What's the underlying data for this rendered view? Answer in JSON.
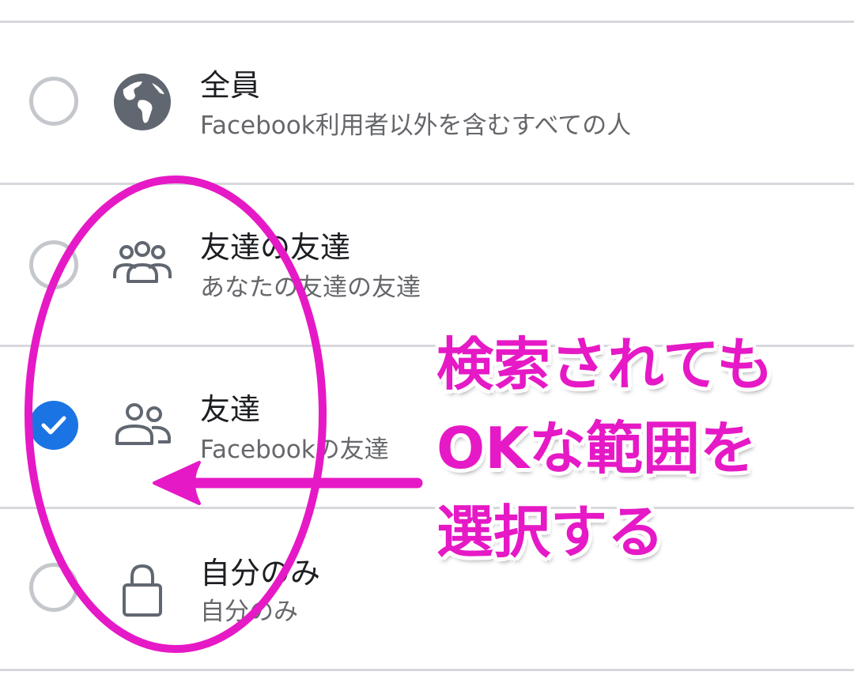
{
  "privacy_options": [
    {
      "title": "全員",
      "subtitle": "Facebook利用者以外を含むすべての人",
      "icon": "globe-icon",
      "selected": false
    },
    {
      "title": "友達の友達",
      "subtitle": "あなたの友達の友達",
      "icon": "friends-of-friends-icon",
      "selected": false
    },
    {
      "title": "友達",
      "subtitle": "Facebookの友達",
      "icon": "friends-icon",
      "selected": true
    },
    {
      "title": "自分のみ",
      "subtitle": "自分のみ",
      "icon": "lock-icon",
      "selected": false
    }
  ],
  "annotation": {
    "lines": [
      "検索されても",
      "OKな範囲を",
      "選択する"
    ],
    "color": "#e619c6"
  },
  "colors": {
    "accent": "#1b74e4",
    "icon": "#606770",
    "divider": "#d6d8dc"
  }
}
